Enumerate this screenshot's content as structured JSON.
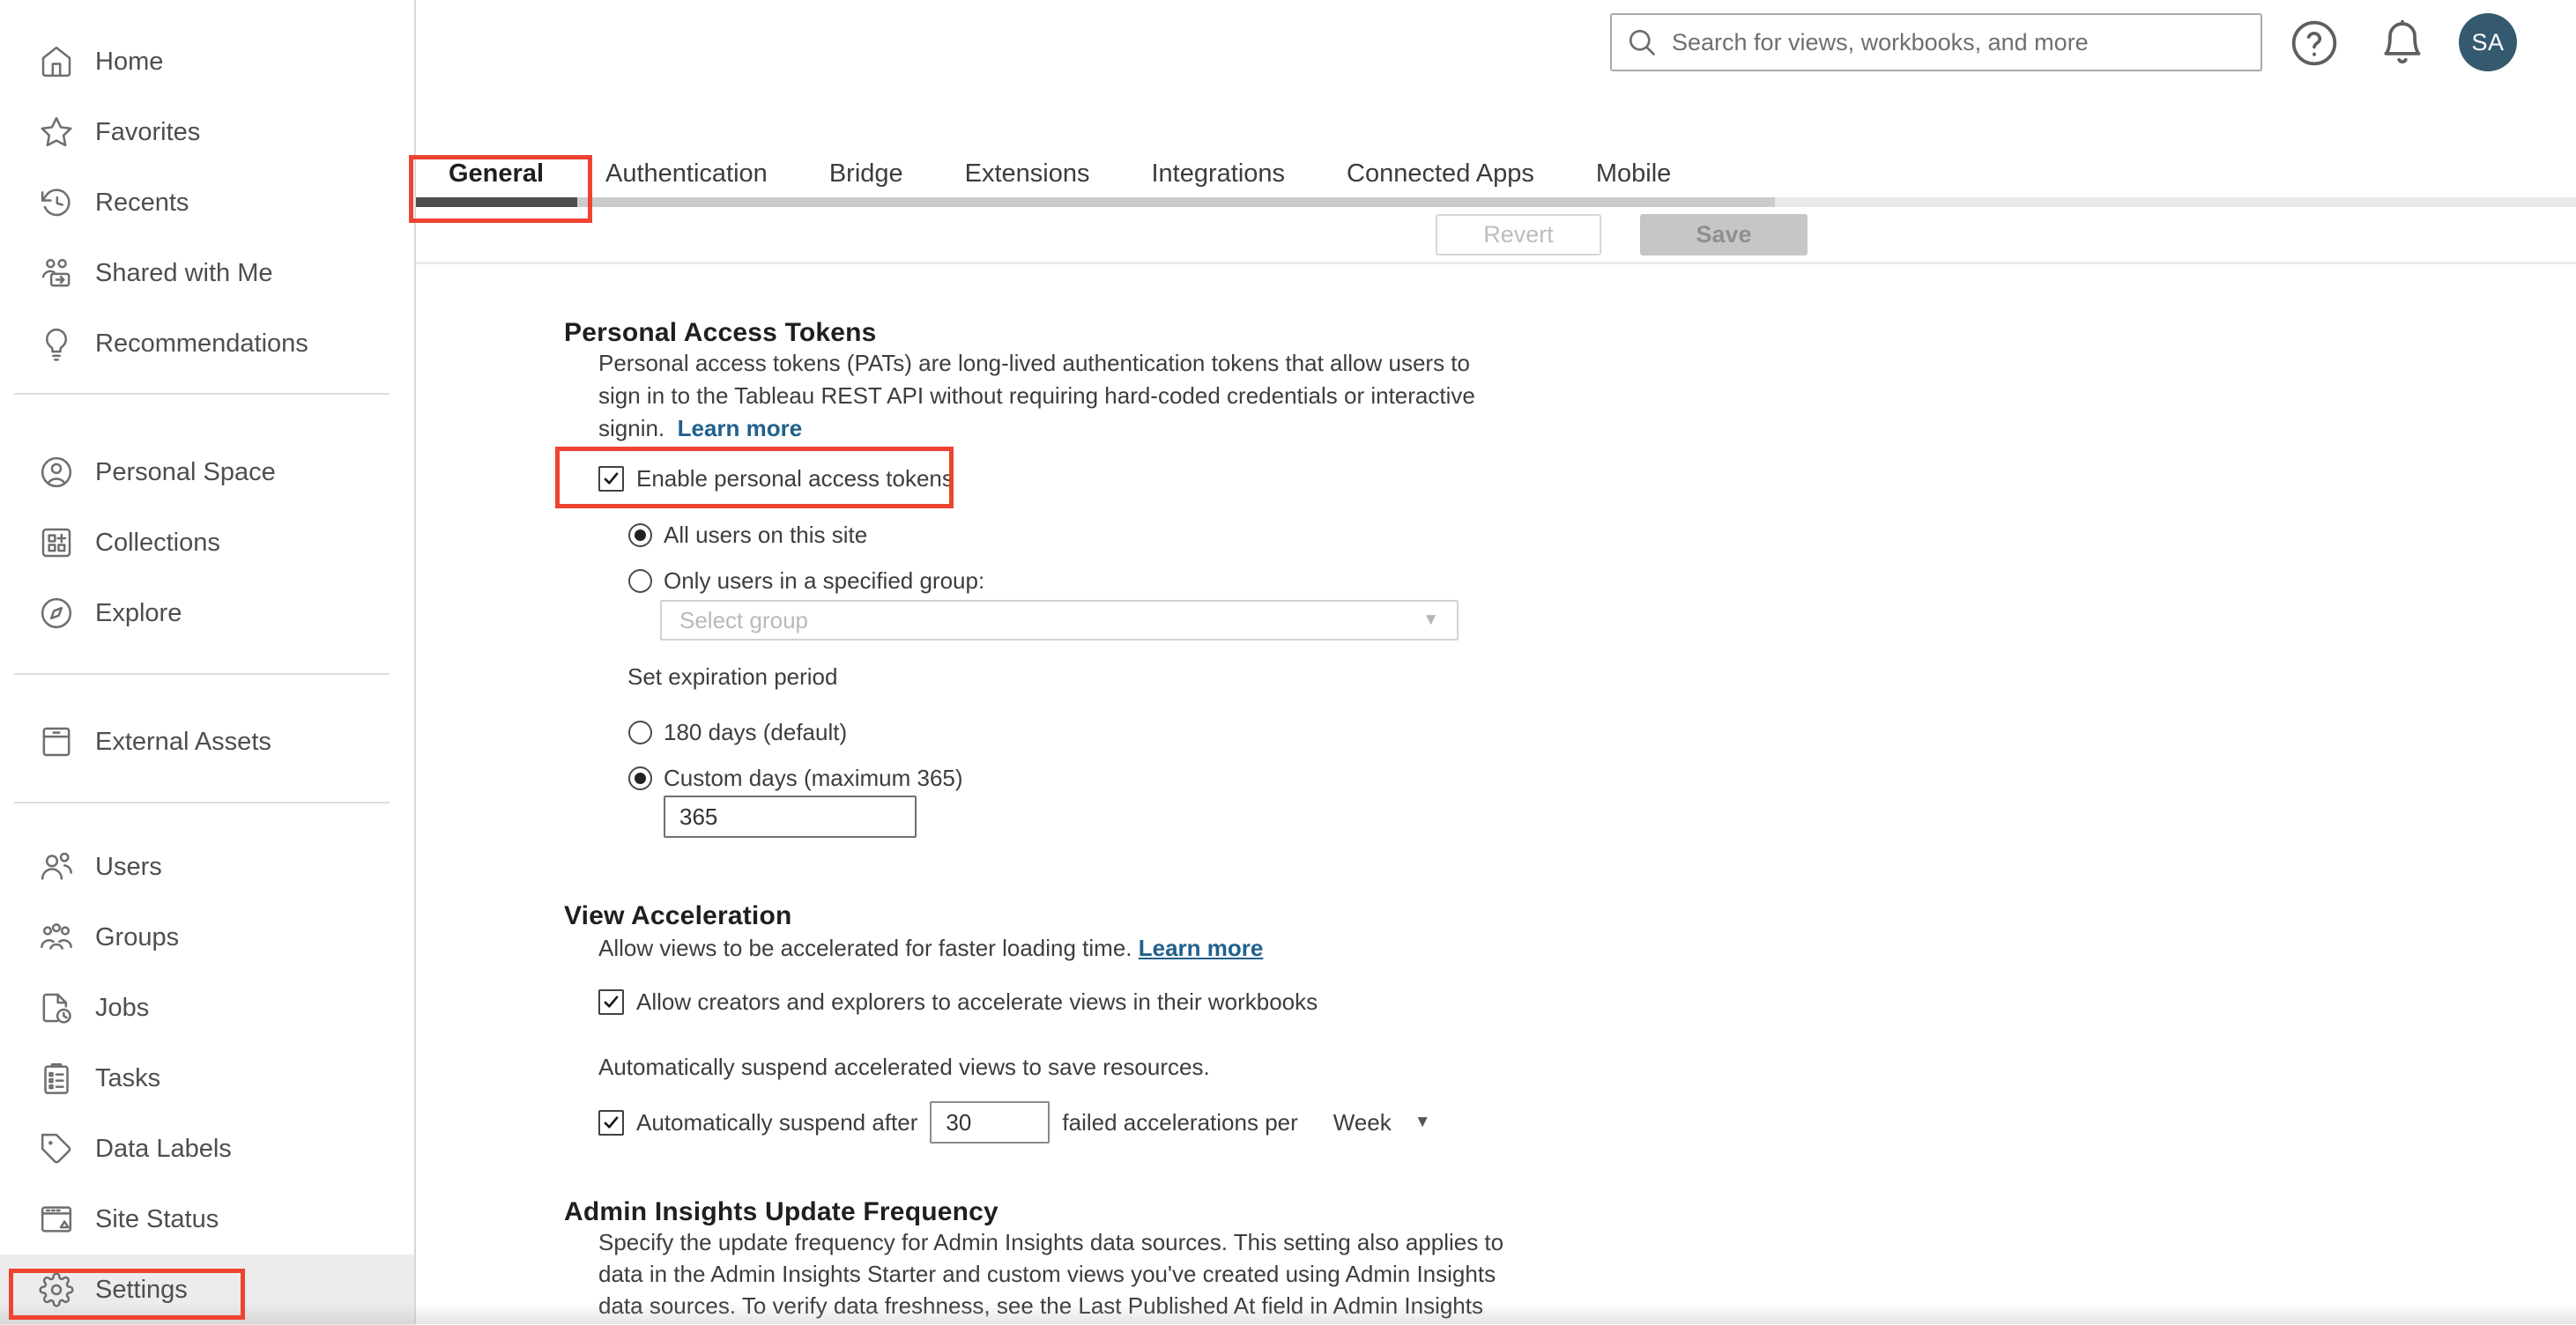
{
  "header": {
    "search_placeholder": "Search for views, workbooks, and more",
    "avatar_initials": "SA"
  },
  "sidebar": {
    "items": [
      {
        "label": "Home"
      },
      {
        "label": "Favorites"
      },
      {
        "label": "Recents"
      },
      {
        "label": "Shared with Me"
      },
      {
        "label": "Recommendations"
      },
      {
        "label": "Personal Space"
      },
      {
        "label": "Collections"
      },
      {
        "label": "Explore"
      },
      {
        "label": "External Assets"
      },
      {
        "label": "Users"
      },
      {
        "label": "Groups"
      },
      {
        "label": "Jobs"
      },
      {
        "label": "Tasks"
      },
      {
        "label": "Data Labels"
      },
      {
        "label": "Site Status"
      },
      {
        "label": "Settings"
      }
    ]
  },
  "tabs": [
    "General",
    "Authentication",
    "Bridge",
    "Extensions",
    "Integrations",
    "Connected Apps",
    "Mobile"
  ],
  "toolbar": {
    "revert": "Revert",
    "save": "Save"
  },
  "pat": {
    "heading": "Personal Access Tokens",
    "desc_line1": "Personal access tokens (PATs) are long-lived authentication tokens that allow users to",
    "desc_line2": "sign in to the Tableau REST API without requiring hard-coded credentials or interactive",
    "desc_line3": "signin.",
    "learn_more": "Learn more",
    "enable_label": "Enable personal access tokens",
    "radio_all_users": "All users on this site",
    "radio_specified_group": "Only users in a specified group:",
    "select_group_placeholder": "Select group",
    "expiration_label": "Set expiration period",
    "radio_default": "180 days (default)",
    "radio_custom": "Custom days (maximum 365)",
    "custom_days_value": "365"
  },
  "view_acceleration": {
    "heading": "View Acceleration",
    "intro": "Allow views to be accelerated for faster loading time.",
    "learn_more": "Learn more",
    "allow_label": "Allow creators and explorers to accelerate views in their workbooks",
    "suspend_note": "Automatically suspend accelerated views to save resources.",
    "suspend_prefix": "Automatically suspend after",
    "suspend_value": "30",
    "suspend_suffix": "failed accelerations per",
    "period": "Week"
  },
  "admin_insights": {
    "heading": "Admin Insights Update Frequency",
    "desc_line1": "Specify the update frequency for Admin Insights data sources. This setting also applies to",
    "desc_line2": "data in the Admin Insights Starter and custom views you've created using Admin Insights",
    "desc_line3": "data sources. To verify data freshness, see the Last Published At field in Admin Insights"
  },
  "icons": {
    "caret_down": "▼"
  },
  "colors": {
    "annotation_red": "#ee4331",
    "avatar_bg": "#35596e",
    "link_blue": "#21618c"
  }
}
